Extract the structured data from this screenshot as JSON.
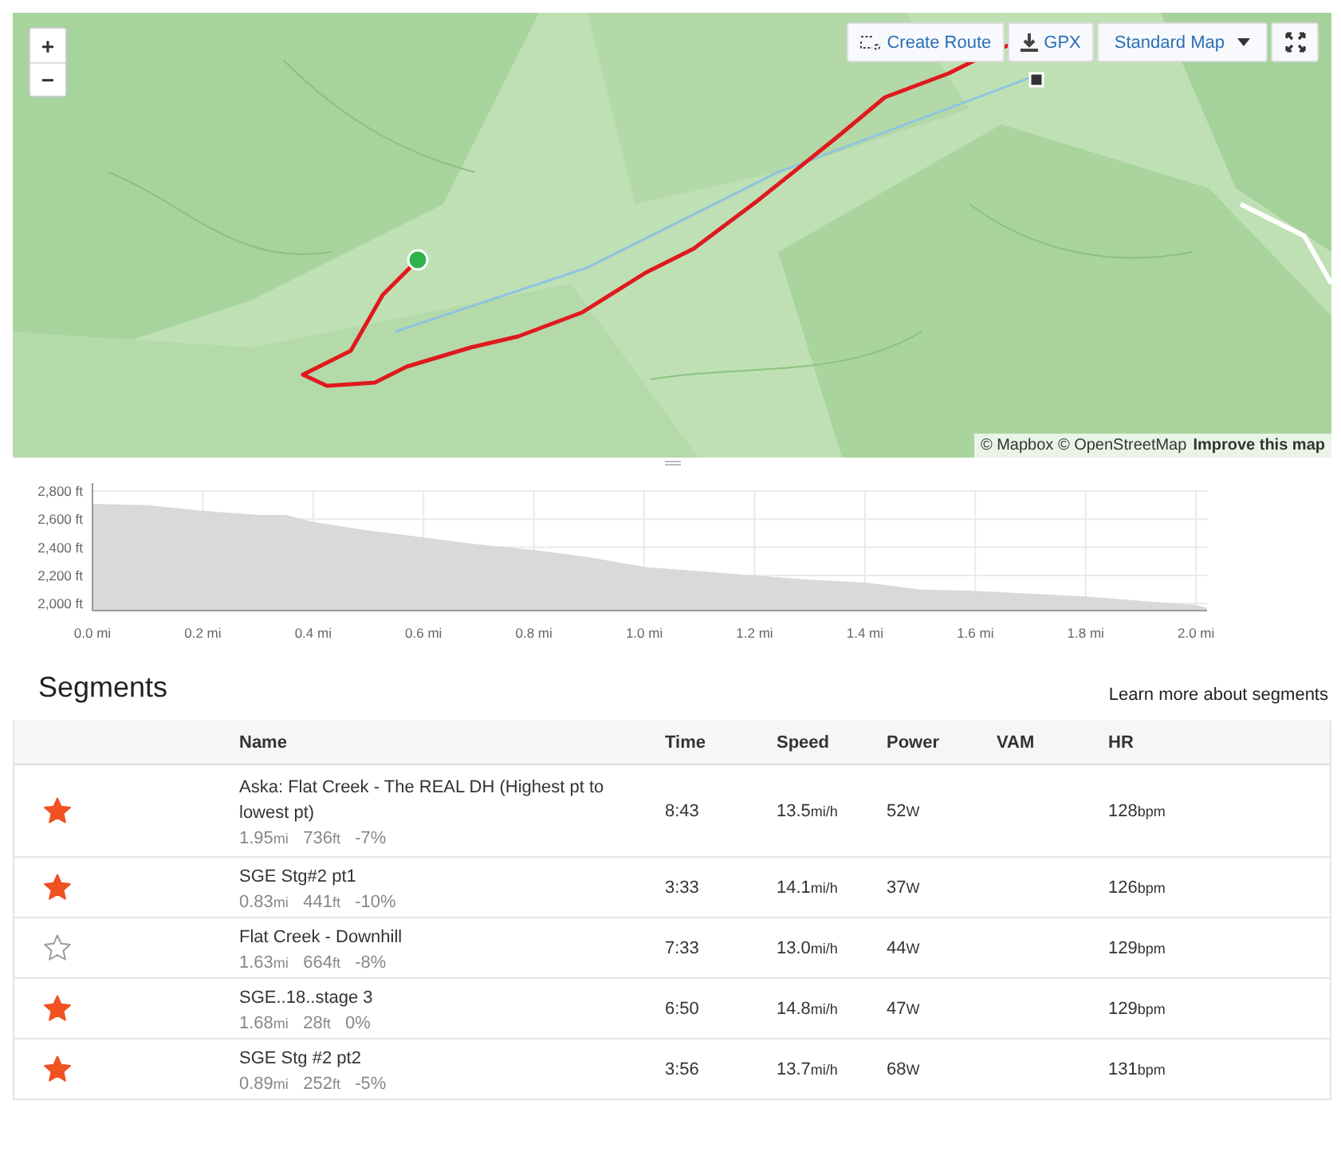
{
  "map": {
    "kind": "picture",
    "zoom_buttons": [
      "+",
      "−"
    ],
    "toolbar": [
      {
        "kind": "route",
        "label": "Create Route"
      },
      {
        "kind": "download",
        "label": "GPX"
      },
      {
        "kind": "dropdown",
        "label": "Standard Map"
      },
      {
        "kind": "fullscreen"
      }
    ],
    "attribution": {
      "text": "© Mapbox © OpenStreetMap",
      "link": "Improve this map"
    }
  },
  "elevation": {
    "chart_data": {
      "type": "area",
      "x": [
        0,
        0.1,
        0.2,
        0.3,
        0.35,
        0.4,
        0.5,
        0.6,
        0.7,
        0.8,
        0.9,
        1.0,
        1.1,
        1.2,
        1.3,
        1.4,
        1.5,
        1.6,
        1.7,
        1.8,
        1.9,
        2.0,
        2.02
      ],
      "series": [
        {
          "color": "#d9d9d9",
          "values": [
            2710,
            2700,
            2660,
            2630,
            2630,
            2580,
            2520,
            2470,
            2420,
            2380,
            2330,
            2260,
            2230,
            2200,
            2170,
            2150,
            2100,
            2090,
            2070,
            2050,
            2020,
            1990,
            1970
          ]
        }
      ],
      "xlim": [
        0,
        2.02
      ],
      "ylim": [
        1950,
        2800
      ],
      "grid": true,
      "xticks": [
        {
          "value": 0,
          "label": "0.0 mi"
        },
        {
          "value": 0.2,
          "label": "0.2 mi"
        },
        {
          "value": 0.4,
          "label": "0.4 mi"
        },
        {
          "value": 0.6,
          "label": "0.6 mi"
        },
        {
          "value": 0.8,
          "label": "0.8 mi"
        },
        {
          "value": 1.0,
          "label": "1.0 mi"
        },
        {
          "value": 1.2,
          "label": "1.2 mi"
        },
        {
          "value": 1.4,
          "label": "1.4 mi"
        },
        {
          "value": 1.6,
          "label": "1.6 mi"
        },
        {
          "value": 1.8,
          "label": "1.8 mi"
        },
        {
          "value": 2.0,
          "label": "2.0 mi"
        }
      ],
      "yticks": [
        {
          "value": 2000,
          "label": "2,000 ft"
        },
        {
          "value": 2200,
          "label": "2,200 ft"
        },
        {
          "value": 2400,
          "label": "2,400 ft"
        },
        {
          "value": 2600,
          "label": "2,600 ft"
        },
        {
          "value": 2800,
          "label": "2,800 ft"
        }
      ]
    }
  },
  "segments": {
    "title": "Segments",
    "learn_more": "Learn more about segments",
    "columns": [
      "Name",
      "Time",
      "Speed",
      "Power",
      "VAM",
      "HR"
    ],
    "rows": [
      {
        "starred": true,
        "name": "Aska: Flat Creek - The REAL DH (Highest pt to lowest pt)",
        "distance": [
          "1.95",
          "mi"
        ],
        "elevation": [
          "736",
          "ft"
        ],
        "grade": "-7%",
        "time": "8:43",
        "speed": [
          "13.5",
          "mi/h"
        ],
        "power": [
          "52",
          "W"
        ],
        "hr": [
          "128",
          "bpm"
        ]
      },
      {
        "starred": true,
        "name": "SGE Stg#2 pt1",
        "distance": [
          "0.83",
          "mi"
        ],
        "elevation": [
          "441",
          "ft"
        ],
        "grade": "-10%",
        "time": "3:33",
        "speed": [
          "14.1",
          "mi/h"
        ],
        "power": [
          "37",
          "W"
        ],
        "hr": [
          "126",
          "bpm"
        ]
      },
      {
        "starred": false,
        "name": "Flat Creek - Downhill",
        "distance": [
          "1.63",
          "mi"
        ],
        "elevation": [
          "664",
          "ft"
        ],
        "grade": "-8%",
        "time": "7:33",
        "speed": [
          "13.0",
          "mi/h"
        ],
        "power": [
          "44",
          "W"
        ],
        "hr": [
          "129",
          "bpm"
        ]
      },
      {
        "starred": true,
        "name": "SGE..18..stage 3",
        "distance": [
          "1.68",
          "mi"
        ],
        "elevation": [
          "28",
          "ft"
        ],
        "grade": "0%",
        "time": "6:50",
        "speed": [
          "14.8",
          "mi/h"
        ],
        "power": [
          "47",
          "W"
        ],
        "hr": [
          "129",
          "bpm"
        ]
      },
      {
        "starred": true,
        "name": "SGE Stg #2 pt2",
        "distance": [
          "0.89",
          "mi"
        ],
        "elevation": [
          "252",
          "ft"
        ],
        "grade": "-5%",
        "time": "3:56",
        "speed": [
          "13.7",
          "mi/h"
        ],
        "power": [
          "68",
          "W"
        ],
        "hr": [
          "131",
          "bpm"
        ]
      }
    ]
  }
}
